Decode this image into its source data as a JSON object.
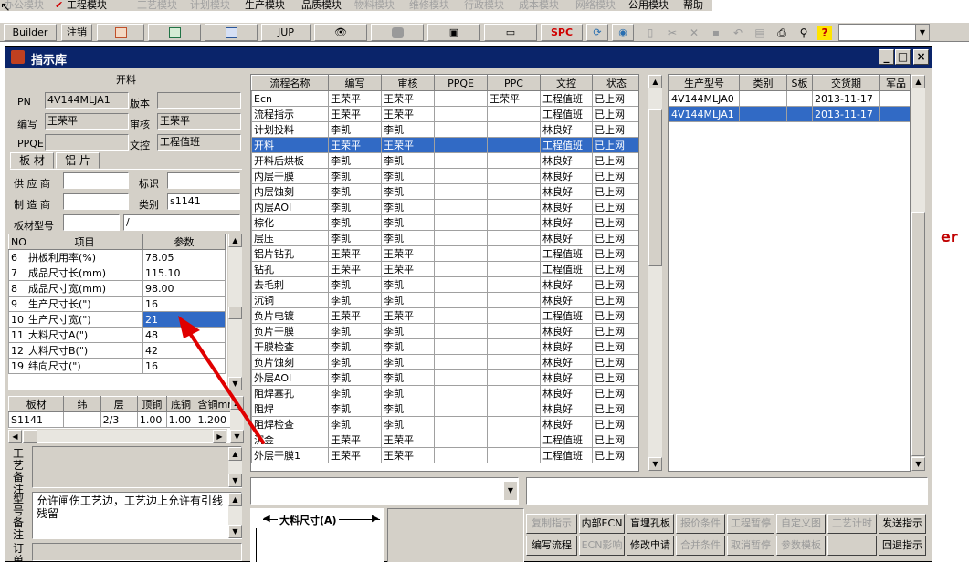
{
  "menu": [
    {
      "label": "办公模块",
      "active": false
    },
    {
      "label": "工程模块",
      "active": true
    },
    {
      "label": "工艺模块",
      "active": false
    },
    {
      "label": "计划模块",
      "active": false
    },
    {
      "label": "生产模块",
      "active": true
    },
    {
      "label": "品质模块",
      "active": true
    },
    {
      "label": "物料模块",
      "active": false
    },
    {
      "label": "维修模块",
      "active": false
    },
    {
      "label": "行政模块",
      "active": false
    },
    {
      "label": "成本模块",
      "active": false
    },
    {
      "label": "网络模块",
      "active": false
    },
    {
      "label": "公用模块",
      "active": true
    },
    {
      "label": "帮助",
      "active": true
    }
  ],
  "toolbar": {
    "builder": "Builder",
    "logout": "注销",
    "jup": "JUP",
    "spc": "SPC"
  },
  "window": {
    "title": "指示库"
  },
  "left": {
    "section_title": "开料",
    "pn_label": "PN",
    "pn_value": "4V144MLJA1",
    "version_label": "版本",
    "version_value": "",
    "editor_label": "编写",
    "editor_value": "王荣平",
    "reviewer_label": "审核",
    "reviewer_value": "王荣平",
    "ppqe_label": "PPQE",
    "ppqe_value": "",
    "doc_control_label": "文控",
    "doc_control_value": "工程值班",
    "tabs": [
      "板 材",
      "铝 片"
    ],
    "supplier_label": "供 应 商",
    "supplier_value": "",
    "mark_label": "标识",
    "mark_value": "",
    "maker_label": "制 造 商",
    "maker_value": "",
    "category_label": "类别",
    "category_value": "s1141",
    "board_model_label": "板材型号",
    "board_model_value": "",
    "board_model_value2": "/"
  },
  "params": {
    "headers": [
      "NO",
      "项目",
      "参数"
    ],
    "rows": [
      {
        "no": "6",
        "item": "拼板利用率(%)",
        "value": "78.05"
      },
      {
        "no": "7",
        "item": "成品尺寸长(mm)",
        "value": "115.10"
      },
      {
        "no": "8",
        "item": "成品尺寸宽(mm)",
        "value": "98.00"
      },
      {
        "no": "9",
        "item": "生产尺寸长(\")",
        "value": "16"
      },
      {
        "no": "10",
        "item": "生产尺寸宽(\")",
        "value": "21"
      },
      {
        "no": "11",
        "item": "大料尺寸A(\")",
        "value": "48"
      },
      {
        "no": "12",
        "item": "大料尺寸B(\")",
        "value": "42"
      },
      {
        "no": "19",
        "item": "纬向尺寸(\")",
        "value": "16"
      }
    ]
  },
  "board": {
    "headers": [
      "板材",
      "纬",
      "层",
      "顶铜",
      "底铜",
      "含铜mm"
    ],
    "rows": [
      {
        "board": "S1141",
        "weft": "",
        "layer": "2/3",
        "top": "1.00",
        "bottom": "1.00",
        "cu": "1.200"
      }
    ]
  },
  "remarks": {
    "process_label": "工艺备注",
    "process_value": "",
    "model_label": "型号备注",
    "model_value": "允许闸伤工艺边，工艺边上允许有引线残留",
    "order_label": "订单"
  },
  "flow": {
    "headers": [
      "流程名称",
      "编写",
      "审核",
      "PPQE",
      "PPC",
      "文控",
      "状态"
    ],
    "rows": [
      {
        "name": "Ecn",
        "editor": "王荣平",
        "reviewer": "王荣平",
        "ppqe": "",
        "ppc": "王荣平",
        "doc": "工程值班",
        "status": "已上网"
      },
      {
        "name": "流程指示",
        "editor": "王荣平",
        "reviewer": "王荣平",
        "ppqe": "",
        "ppc": "",
        "doc": "工程值班",
        "status": "已上网"
      },
      {
        "name": "计划投料",
        "editor": "李凯",
        "reviewer": "李凯",
        "ppqe": "",
        "ppc": "",
        "doc": "林良好",
        "status": "已上网"
      },
      {
        "name": "开料",
        "editor": "王荣平",
        "reviewer": "王荣平",
        "ppqe": "",
        "ppc": "",
        "doc": "工程值班",
        "status": "已上网"
      },
      {
        "name": "开料后烘板",
        "editor": "李凯",
        "reviewer": "李凯",
        "ppqe": "",
        "ppc": "",
        "doc": "林良好",
        "status": "已上网"
      },
      {
        "name": "内层干膜",
        "editor": "李凯",
        "reviewer": "李凯",
        "ppqe": "",
        "ppc": "",
        "doc": "林良好",
        "status": "已上网"
      },
      {
        "name": "内层蚀刻",
        "editor": "李凯",
        "reviewer": "李凯",
        "ppqe": "",
        "ppc": "",
        "doc": "林良好",
        "status": "已上网"
      },
      {
        "name": "内层AOI",
        "editor": "李凯",
        "reviewer": "李凯",
        "ppqe": "",
        "ppc": "",
        "doc": "林良好",
        "status": "已上网"
      },
      {
        "name": "棕化",
        "editor": "李凯",
        "reviewer": "李凯",
        "ppqe": "",
        "ppc": "",
        "doc": "林良好",
        "status": "已上网"
      },
      {
        "name": "层压",
        "editor": "李凯",
        "reviewer": "李凯",
        "ppqe": "",
        "ppc": "",
        "doc": "林良好",
        "status": "已上网"
      },
      {
        "name": "铝片钻孔",
        "editor": "王荣平",
        "reviewer": "王荣平",
        "ppqe": "",
        "ppc": "",
        "doc": "工程值班",
        "status": "已上网"
      },
      {
        "name": "钻孔",
        "editor": "王荣平",
        "reviewer": "王荣平",
        "ppqe": "",
        "ppc": "",
        "doc": "工程值班",
        "status": "已上网"
      },
      {
        "name": "去毛刺",
        "editor": "李凯",
        "reviewer": "李凯",
        "ppqe": "",
        "ppc": "",
        "doc": "林良好",
        "status": "已上网"
      },
      {
        "name": "沉铜",
        "editor": "李凯",
        "reviewer": "李凯",
        "ppqe": "",
        "ppc": "",
        "doc": "林良好",
        "status": "已上网"
      },
      {
        "name": "负片电镀",
        "editor": "王荣平",
        "reviewer": "王荣平",
        "ppqe": "",
        "ppc": "",
        "doc": "工程值班",
        "status": "已上网"
      },
      {
        "name": "负片干膜",
        "editor": "李凯",
        "reviewer": "李凯",
        "ppqe": "",
        "ppc": "",
        "doc": "林良好",
        "status": "已上网"
      },
      {
        "name": "干膜检查",
        "editor": "李凯",
        "reviewer": "李凯",
        "ppqe": "",
        "ppc": "",
        "doc": "林良好",
        "status": "已上网"
      },
      {
        "name": "负片蚀刻",
        "editor": "李凯",
        "reviewer": "李凯",
        "ppqe": "",
        "ppc": "",
        "doc": "林良好",
        "status": "已上网"
      },
      {
        "name": "外层AOI",
        "editor": "李凯",
        "reviewer": "李凯",
        "ppqe": "",
        "ppc": "",
        "doc": "林良好",
        "status": "已上网"
      },
      {
        "name": "阻焊塞孔",
        "editor": "李凯",
        "reviewer": "李凯",
        "ppqe": "",
        "ppc": "",
        "doc": "林良好",
        "status": "已上网"
      },
      {
        "name": "阻焊",
        "editor": "李凯",
        "reviewer": "李凯",
        "ppqe": "",
        "ppc": "",
        "doc": "林良好",
        "status": "已上网"
      },
      {
        "name": "阻焊检查",
        "editor": "李凯",
        "reviewer": "李凯",
        "ppqe": "",
        "ppc": "",
        "doc": "林良好",
        "status": "已上网"
      },
      {
        "name": "沉金",
        "editor": "王荣平",
        "reviewer": "王荣平",
        "ppqe": "",
        "ppc": "",
        "doc": "工程值班",
        "status": "已上网"
      },
      {
        "name": "外层干膜1",
        "editor": "王荣平",
        "reviewer": "王荣平",
        "ppqe": "",
        "ppc": "",
        "doc": "工程值班",
        "status": "已上网"
      }
    ]
  },
  "models": {
    "headers": [
      "生产型号",
      "类别",
      "S板",
      "交货期",
      "军品"
    ],
    "rows": [
      {
        "model": "4V144MLJA0",
        "category": "",
        "s": "",
        "date": "2013-11-17",
        "mil": ""
      },
      {
        "model": "4V144MLJA1",
        "category": "",
        "s": "",
        "date": "2013-11-17",
        "mil": ""
      }
    ]
  },
  "drawing": {
    "label": "大料尺寸(A)"
  },
  "buttons": {
    "row1": [
      {
        "label": "复制指示",
        "enabled": false
      },
      {
        "label": "内部ECN",
        "enabled": true
      },
      {
        "label": "盲埋孔板",
        "enabled": true
      },
      {
        "label": "报价条件",
        "enabled": false
      },
      {
        "label": "工程暂停",
        "enabled": false
      },
      {
        "label": "自定义图",
        "enabled": false
      },
      {
        "label": "工艺计时",
        "enabled": false
      },
      {
        "label": "发送指示",
        "enabled": true
      }
    ],
    "row2": [
      {
        "label": "编写流程",
        "enabled": true
      },
      {
        "label": "ECN影响",
        "enabled": false
      },
      {
        "label": "修改申请",
        "enabled": true
      },
      {
        "label": "合并条件",
        "enabled": false
      },
      {
        "label": "取消暂停",
        "enabled": false
      },
      {
        "label": "参数模板",
        "enabled": false
      },
      {
        "label": "",
        "enabled": false
      },
      {
        "label": "回退指示",
        "enabled": true
      }
    ]
  },
  "selection": {
    "flow_row": 3,
    "param_row": 4,
    "model_row": 1
  },
  "colors": {
    "titlebar": "#0a246a",
    "selection": "#316ac5",
    "annotation_arrow": "#e00000"
  }
}
